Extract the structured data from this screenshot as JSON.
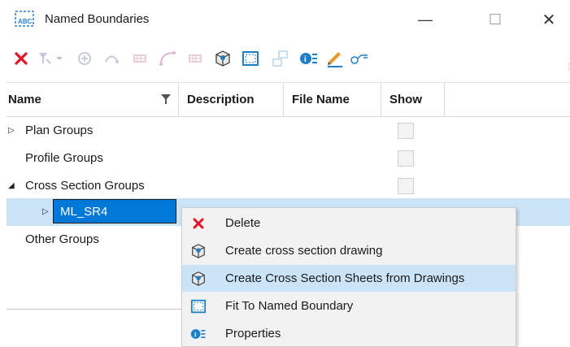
{
  "window": {
    "title": "Named Boundaries",
    "controls": {
      "minimize": "—",
      "maximize": "☐",
      "close": "✕"
    }
  },
  "toolbar": {
    "buttons": [
      {
        "name": "delete-icon",
        "enabled": true
      },
      {
        "name": "filter-dropdown-icon",
        "enabled": false
      },
      {
        "name": "civil-plan-icon",
        "enabled": false
      },
      {
        "name": "profile-icon",
        "enabled": false
      },
      {
        "name": "cross-section-grid-icon",
        "enabled": false
      },
      {
        "name": "curve-icon",
        "enabled": false
      },
      {
        "name": "section-grid-icon",
        "enabled": false
      },
      {
        "name": "create-drawing-icon",
        "enabled": true
      },
      {
        "name": "fit-boundary-icon",
        "enabled": true
      },
      {
        "name": "group-icon",
        "enabled": false
      },
      {
        "name": "properties-icon",
        "enabled": true
      },
      {
        "name": "edit-pencil-icon",
        "enabled": true
      },
      {
        "name": "link-key-icon",
        "enabled": true
      }
    ]
  },
  "grid": {
    "columns": [
      "Name",
      "Description",
      "File Name",
      "Show"
    ],
    "rows": [
      {
        "label": "Plan Groups",
        "expander": "▷",
        "indent": 1
      },
      {
        "label": "Profile Groups",
        "expander": "",
        "indent": 1
      },
      {
        "label": "Cross Section Groups",
        "expander": "◢",
        "indent": 1
      },
      {
        "label": "ML_SR4",
        "expander": "▷",
        "indent": 2,
        "selected": true
      },
      {
        "label": "Other Groups",
        "expander": "",
        "indent": 1
      }
    ]
  },
  "context_menu": {
    "items": [
      {
        "label": "Delete",
        "icon": "delete-icon"
      },
      {
        "label": "Create cross section drawing",
        "icon": "create-drawing-icon"
      },
      {
        "label": "Create Cross Section Sheets from Drawings",
        "icon": "create-sheets-icon",
        "highlighted": true
      },
      {
        "label": "Fit To Named Boundary",
        "icon": "fit-boundary-icon"
      },
      {
        "label": "Properties",
        "icon": "properties-icon"
      }
    ]
  },
  "colors": {
    "selection": "#0078d7",
    "row_highlight": "#cce4f7",
    "delete_red": "#e81123",
    "accent_blue": "#1f7fc4"
  }
}
